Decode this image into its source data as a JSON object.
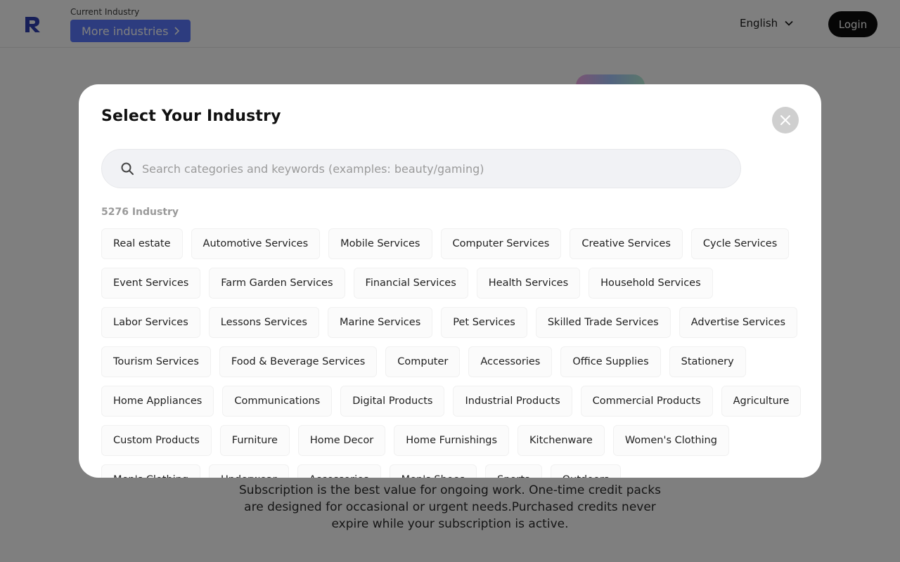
{
  "header": {
    "industry_caption": "Current Industry",
    "industry_button_label": "More industries",
    "language_label": "English",
    "login_label": "Login"
  },
  "background": {
    "description": "Subscription is the best value for ongoing work. One-time credit packs are designed for occasional or urgent needs.Purchased credits never expire while your subscription is active."
  },
  "modal": {
    "title": "Select Your Industry",
    "search_placeholder": "Search categories and keywords (examples: beauty/gaming)",
    "count_label": "5276 Industry",
    "industries": [
      "Real estate",
      "Automotive Services",
      "Mobile Services",
      "Computer Services",
      "Creative Services",
      "Cycle Services",
      "Event Services",
      "Farm Garden Services",
      "Financial Services",
      "Health Services",
      "Household Services",
      "Labor Services",
      "Lessons Services",
      "Marine Services",
      "Pet Services",
      "Skilled Trade Services",
      "Advertise Services",
      "Tourism Services",
      "Food & Beverage Services",
      "Computer",
      "Accessories",
      "Office Supplies",
      "Stationery",
      "Home Appliances",
      "Communications",
      "Digital Products",
      "Industrial Products",
      "Commercial Products",
      "Agriculture",
      "Custom Products",
      "Furniture",
      "Home Decor",
      "Home Furnishings",
      "Kitchenware",
      "Women's Clothing",
      "Men's Clothing",
      "Underwear",
      "Accessories",
      "Men's Shoes",
      "Sports",
      "Outdoors"
    ]
  },
  "colors": {
    "accent": "#5a79ff",
    "login_bg": "#0c0c0c",
    "overlay": "rgba(0,0,0,0.5)"
  },
  "icons": {
    "logo": "brand-logo-icon",
    "industry_chevron": "chevron-right-icon",
    "language_chevron": "chevron-down-icon",
    "close": "close-icon",
    "search": "search-icon"
  }
}
